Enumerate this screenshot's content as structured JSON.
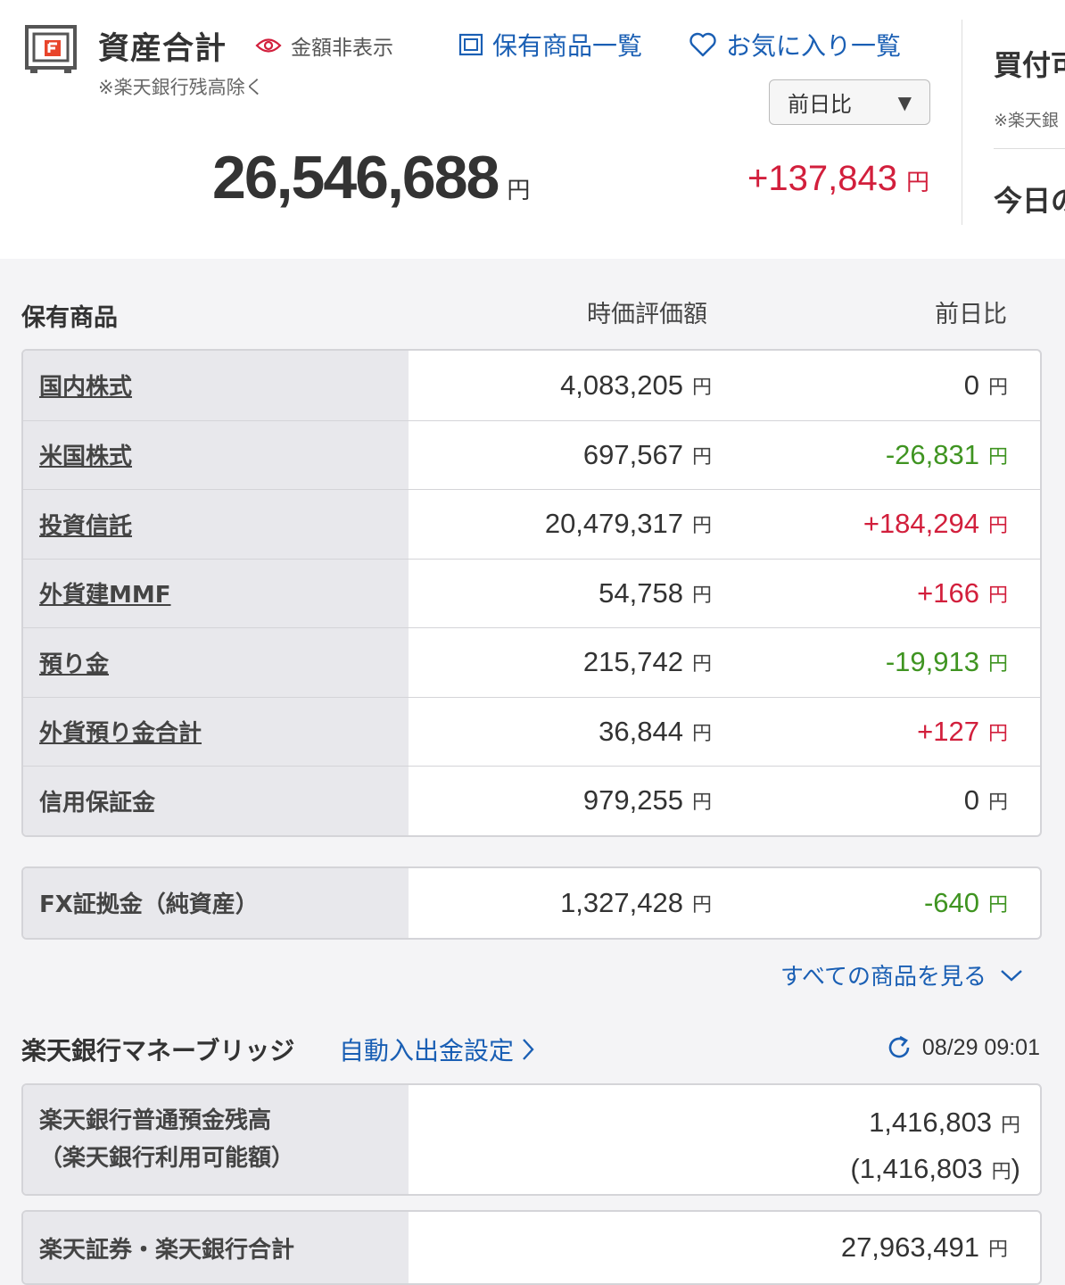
{
  "header": {
    "title": "資産合計",
    "hide_amount_label": "金額非表示",
    "note": "※楽天銀行残高除く",
    "links": {
      "holdings": "保有商品一覧",
      "favorites": "お気に入り一覧"
    },
    "compare_select": "前日比",
    "total_value": "26,546,688",
    "total_change": "+137,843",
    "unit": "円"
  },
  "right_panel_peek": {
    "title": "買付可",
    "note": "※楽天銀",
    "today": "今日の"
  },
  "holdings": {
    "section_title": "保有商品",
    "col_value": "時価評価額",
    "col_change": "前日比",
    "rows": [
      {
        "name": "国内株式",
        "value": "4,083,205",
        "change": "0",
        "sign": "zero",
        "link": true
      },
      {
        "name": "米国株式",
        "value": "697,567",
        "change": "-26,831",
        "sign": "neg",
        "link": true
      },
      {
        "name": "投資信託",
        "value": "20,479,317",
        "change": "+184,294",
        "sign": "pos",
        "link": true
      },
      {
        "name": "外貨建MMF",
        "value": "54,758",
        "change": "+166",
        "sign": "pos",
        "link": true
      },
      {
        "name": "預り金",
        "value": "215,742",
        "change": "-19,913",
        "sign": "neg",
        "link": true
      },
      {
        "name": "外貨預り金合計",
        "value": "36,844",
        "change": "+127",
        "sign": "pos",
        "link": true
      },
      {
        "name": "信用保証金",
        "value": "979,255",
        "change": "0",
        "sign": "zero",
        "link": false
      }
    ],
    "fx": {
      "name": "FX証拠金（純資産）",
      "value": "1,327,428",
      "change": "-640",
      "sign": "neg"
    },
    "see_all": "すべての商品を見る"
  },
  "bank": {
    "title": "楽天銀行マネーブリッジ",
    "auto_link": "自動入出金設定",
    "timestamp": "08/29 09:01",
    "balance_label_1": "楽天銀行普通預金残高",
    "balance_label_2": "（楽天銀行利用可能額）",
    "balance": "1,416,803",
    "available": "(1,416,803",
    "available_close": ")",
    "total_label": "楽天証券・楽天銀行合計",
    "total": "27,963,491"
  },
  "colors": {
    "positive": "#d21f3c",
    "negative": "#3f9421",
    "link": "#1a5fb4"
  }
}
